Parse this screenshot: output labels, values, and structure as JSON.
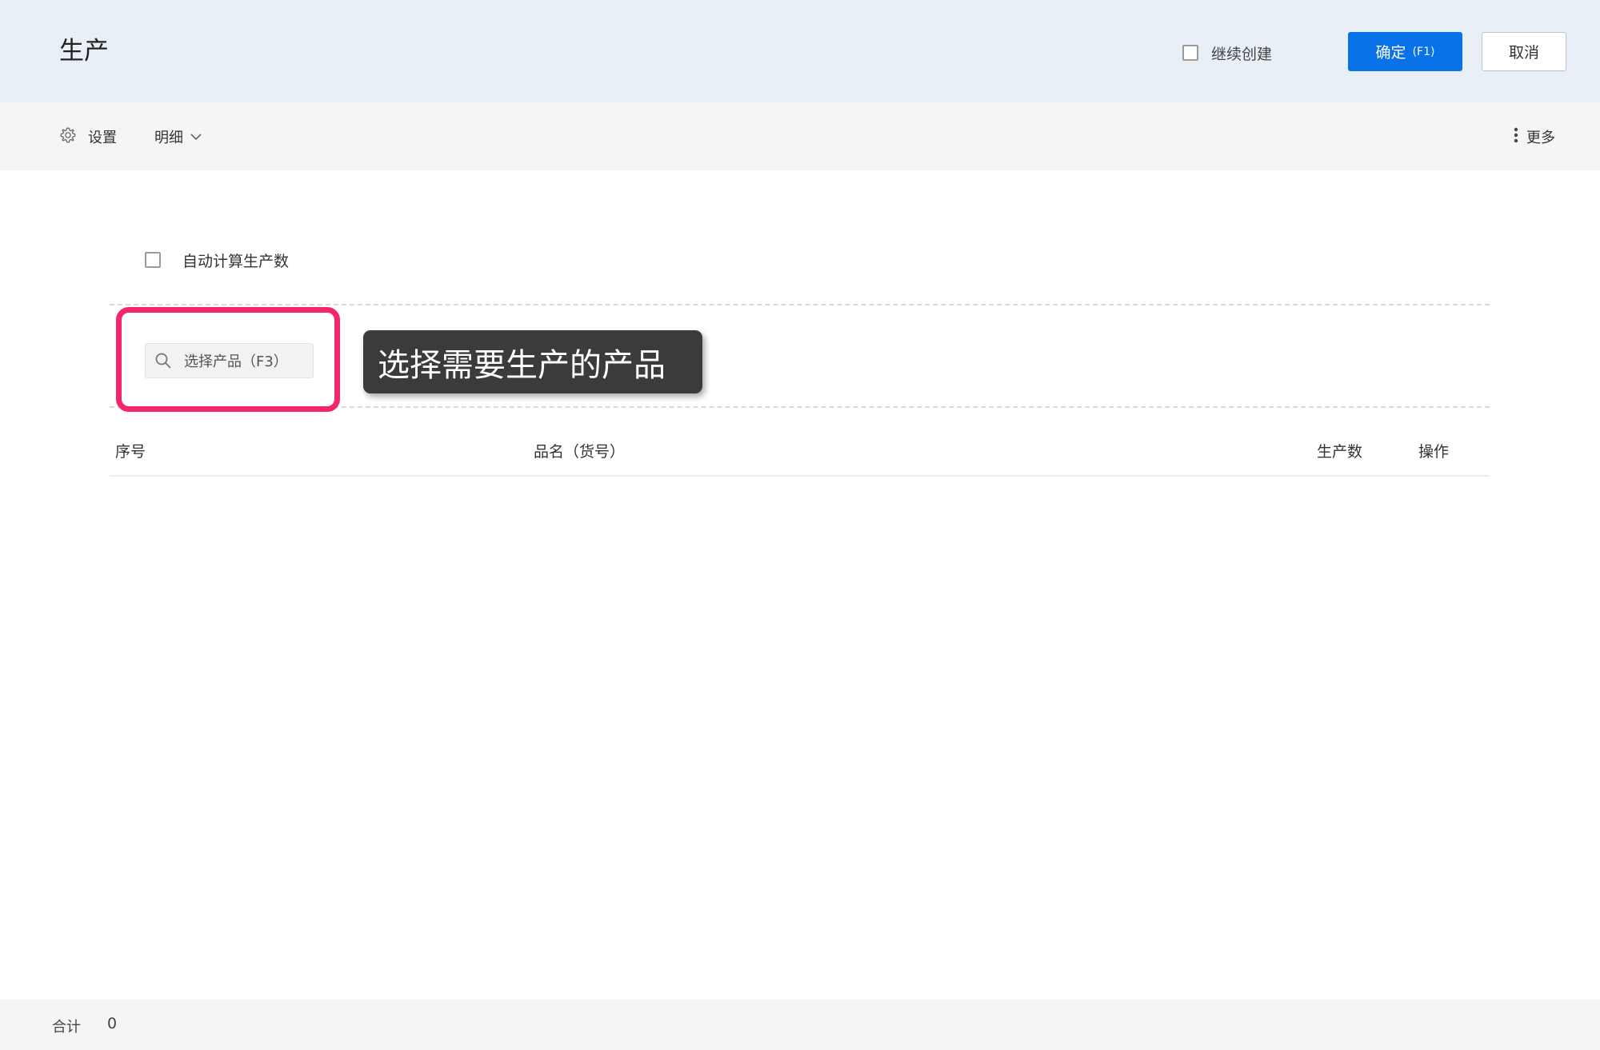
{
  "header": {
    "title": "生产",
    "continue_create_label": "继续创建",
    "continue_create_checked": false,
    "confirm_label": "确定",
    "confirm_hotkey": "(F1)",
    "confirm_color": "#0a72e8",
    "cancel_label": "取消"
  },
  "toolbar": {
    "settings_label": "设置",
    "settings_icon": "gear-icon",
    "detail_label": "明细",
    "detail_icon": "chevron-down-icon",
    "more_label": "更多",
    "more_icon": "vertical-dots-icon"
  },
  "main": {
    "auto_calc_label": "自动计算生产数",
    "auto_calc_checked": false,
    "search_placeholder": "选择产品（F3）",
    "search_icon": "search-icon",
    "tooltip_text": "选择需要生产的产品",
    "highlight_color": "#f6246b"
  },
  "table": {
    "columns": [
      "序号",
      "品名（货号）",
      "生产数",
      "操作"
    ],
    "rows": []
  },
  "footer": {
    "total_label": "合计",
    "total_value": "0"
  }
}
